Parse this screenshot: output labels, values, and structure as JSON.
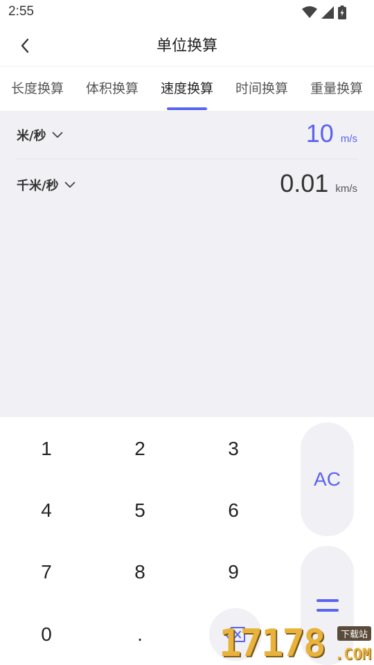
{
  "status_bar": {
    "time": "2:55"
  },
  "header": {
    "title": "单位换算"
  },
  "tabs": [
    {
      "label": "长度换算",
      "active": false
    },
    {
      "label": "体积换算",
      "active": false
    },
    {
      "label": "速度换算",
      "active": true
    },
    {
      "label": "时间换算",
      "active": false
    },
    {
      "label": "重量换算",
      "active": false
    }
  ],
  "conversion": {
    "from": {
      "unit": "米/秒",
      "value": "10",
      "abbr": "m/s"
    },
    "to": {
      "unit": "千米/秒",
      "value": "0.01",
      "abbr": "km/s"
    }
  },
  "keypad": {
    "keys": [
      "1",
      "2",
      "3",
      "4",
      "5",
      "6",
      "7",
      "8",
      "9",
      "0",
      "."
    ],
    "clear_label": "AC",
    "equals_icon": "equals-icon",
    "delete_icon": "backspace-icon"
  },
  "watermark": {
    "digits": "17178",
    "badge": "下载站",
    "suffix": ".COM"
  },
  "colors": {
    "accent": "#5a63ef",
    "panel_bg": "#f0f0f5"
  }
}
